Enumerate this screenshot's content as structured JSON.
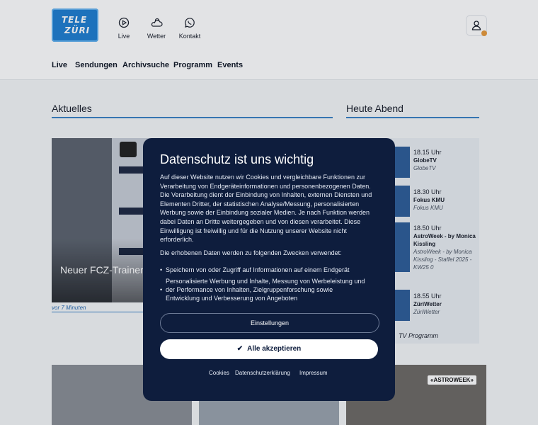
{
  "logo": {
    "line1": "TELE",
    "line2": "ZÜRI"
  },
  "topnav": [
    {
      "label": "Live",
      "icon": "play-circle-icon"
    },
    {
      "label": "Wetter",
      "icon": "cloud-sun-icon"
    },
    {
      "label": "Kontakt",
      "icon": "whatsapp-icon"
    }
  ],
  "mainnav": [
    "Live",
    "Sendungen",
    "Archivsuche",
    "Programm",
    "Events"
  ],
  "sections": {
    "news": "Aktuelles",
    "tonight": "Heute Abend"
  },
  "hero": {
    "headline": "Neuer FCZ-Trainer offiziell vor",
    "time": "vor 7 Minuten"
  },
  "programme": [
    {
      "time": "18.15 Uhr",
      "title": "GlobeTV",
      "sub": "GlobeTV"
    },
    {
      "time": "18.30 Uhr",
      "title": "Fokus KMU",
      "sub": "Fokus KMU"
    },
    {
      "time": "18.50 Uhr",
      "title": "AstroWeek - by Monica Kissling",
      "sub": "AstroWeek - by Monica Kissling - Staffel 2025 - KW25 0"
    },
    {
      "time": "18.55 Uhr",
      "title": "ZüriWetter",
      "sub": "ZüriWetter"
    }
  ],
  "tv_programm_link": "TV Programm",
  "bottom_badge": "«ASTROWEEK»",
  "consent": {
    "title": "Datenschutz ist uns wichtig",
    "intro": "Auf dieser Website nutzen wir Cookies und vergleichbare Funktionen zur Verarbeitung von Endgeräteinformationen und personenbezogenen Daten. Die Verarbeitung dient der Einbindung von Inhalten, externen Diensten und Elementen Dritter, der statistischen Analyse/Messung, personalisierten Werbung sowie der Einbindung sozialer Medien. Je nach Funktion werden dabei Daten an Dritte weitergegeben und von diesen verarbeitet. Diese Einwilligung ist freiwillig und für die Nutzung unserer Website nicht erforderlich.",
    "purposes_heading": "Die erhobenen Daten werden zu folgenden Zwecken verwendet:",
    "purposes": [
      "Speichern von oder Zugriff auf Informationen auf einem Endgerät",
      "Personalisierte Werbung und Inhalte, Messung von Werbeleistung und der Performance von Inhalten, Zielgruppenforschung sowie Entwicklung und Verbesserung von Angeboten"
    ],
    "settings_label": "Einstellungen",
    "accept_label": "Alle akzeptieren",
    "links": [
      "Cookies",
      "Datenschutzerklärung",
      "Impressum"
    ]
  },
  "colors": {
    "brand": "#1f7fd1",
    "modal_bg": "#0e1d3d",
    "accent_line": "#3b82c4",
    "notification": "#e89a3c"
  }
}
